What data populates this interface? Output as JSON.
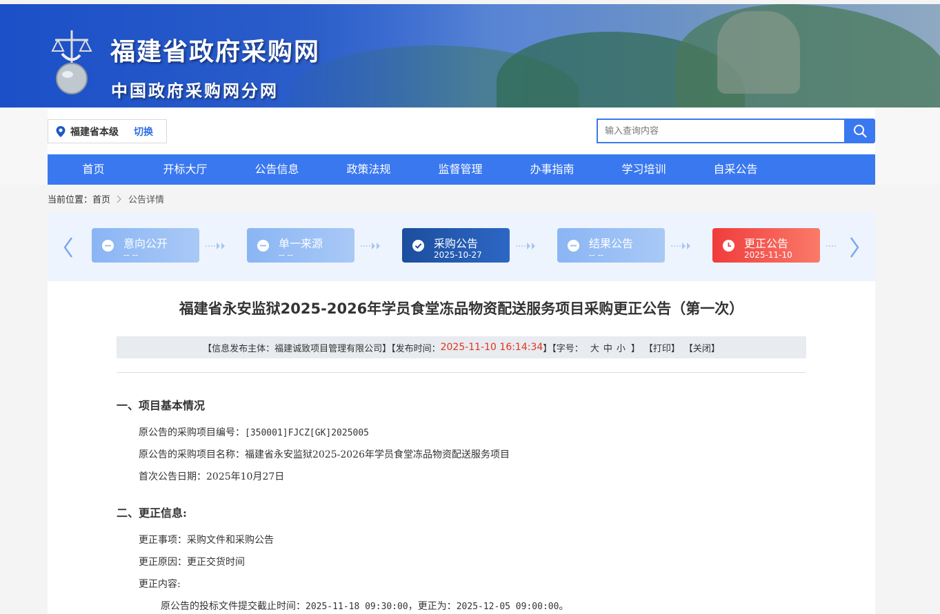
{
  "header": {
    "site_title": "福建省政府采购网",
    "site_subtitle": "中国政府采购网分网",
    "location": "福建省本级",
    "switch_label": "切换",
    "search_placeholder": "输入查询内容"
  },
  "nav": {
    "items": [
      {
        "label": "首页"
      },
      {
        "label": "开标大厅"
      },
      {
        "label": "公告信息"
      },
      {
        "label": "政策法规"
      },
      {
        "label": "监督管理"
      },
      {
        "label": "办事指南"
      },
      {
        "label": "学习培训"
      },
      {
        "label": "自采公告"
      }
    ]
  },
  "breadcrumb": {
    "prefix": "当前位置：",
    "home": "首页",
    "current": "公告详情"
  },
  "steps": [
    {
      "label": "意向公开",
      "date": "-- --",
      "state": "pending"
    },
    {
      "label": "单一来源",
      "date": "-- --",
      "state": "pending"
    },
    {
      "label": "采购公告",
      "date": "2025-10-27",
      "state": "done"
    },
    {
      "label": "结果公告",
      "date": "-- --",
      "state": "pending"
    },
    {
      "label": "更正公告",
      "date": "2025-11-10",
      "state": "current"
    }
  ],
  "article": {
    "title": "福建省永安监狱2025-2026年学员食堂冻品物资配送服务项目采购更正公告（第一次）",
    "meta": {
      "publisher_prefix": "【信息发布主体：福建诚致项目管理有限公司】【发布时间：",
      "publish_time": "2025-11-10 16:14:34",
      "font_prefix": "】【字号：",
      "font_large": "大",
      "font_medium": "中",
      "font_small": "小",
      "font_suffix": "】",
      "print": "【打印】",
      "close": "【关闭】"
    },
    "section1": {
      "heading": "一、项目基本情况",
      "project_no_label": "原公告的采购项目编号：",
      "project_no": "[350001]FJCZ[GK]2025005",
      "project_name_label": "原公告的采购项目名称：",
      "project_name": "福建省永安监狱2025-2026年学员食堂冻品物资配送服务项目",
      "first_date_label": "首次公告日期：",
      "first_date": "2025年10月27日"
    },
    "section2": {
      "heading": "二、更正信息:",
      "matter_label": "更正事项：",
      "matter": "采购文件和采购公告",
      "reason_label": "更正原因：",
      "reason": "更正交货时间",
      "content_label": "更正内容:",
      "content_line_prefix": "原公告的投标文件提交截止时间：",
      "content_old": "2025-11-18 09:30:00",
      "content_mid": "，更正为：",
      "content_new": "2025-12-05 09:00:00",
      "content_end": "。"
    }
  }
}
